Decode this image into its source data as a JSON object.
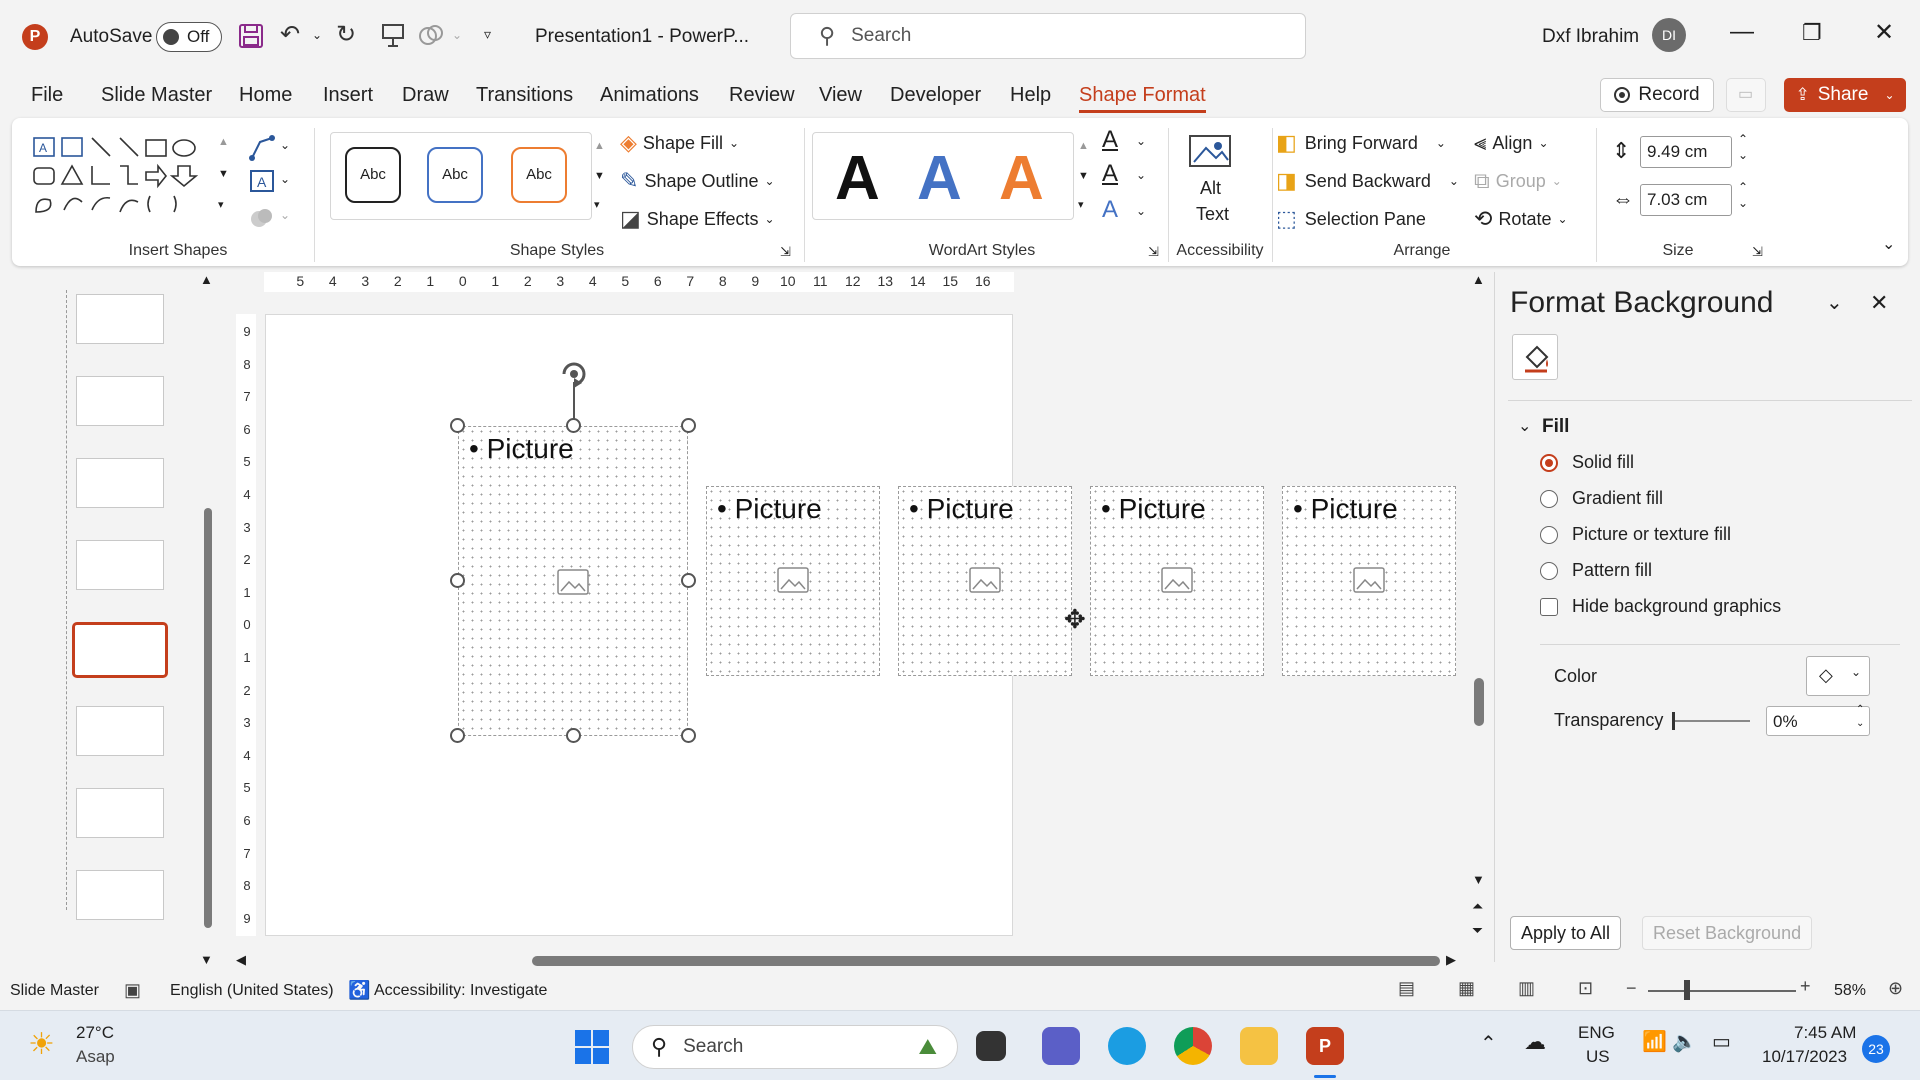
{
  "titlebar": {
    "app_icon": "P",
    "autosave_label": "AutoSave",
    "autosave_state": "Off",
    "doc_title": "Presentation1  -  PowerP...",
    "search_placeholder": "Search",
    "user_name": "Dxf Ibrahim",
    "user_initials": "DI"
  },
  "menu": {
    "items": [
      "File",
      "Slide Master",
      "Home",
      "Insert",
      "Draw",
      "Transitions",
      "Animations",
      "Review",
      "View",
      "Developer",
      "Help",
      "Shape Format"
    ],
    "active": "Shape Format",
    "record_label": "Record",
    "share_label": "Share"
  },
  "ribbon": {
    "insert_shapes_label": "Insert Shapes",
    "shape_styles": {
      "label": "Shape Styles",
      "preset": "Abc",
      "fill": "Shape Fill",
      "outline": "Shape Outline",
      "effects": "Shape Effects"
    },
    "wordart": {
      "label": "WordArt Styles",
      "letter": "A"
    },
    "accessibility": {
      "label": "Accessibility",
      "alt_text_1": "Alt",
      "alt_text_2": "Text"
    },
    "arrange": {
      "label": "Arrange",
      "bring_forward": "Bring Forward",
      "send_backward": "Send Backward",
      "selection_pane": "Selection Pane",
      "align": "Align",
      "group": "Group",
      "rotate": "Rotate"
    },
    "size": {
      "label": "Size",
      "height": "9.49 cm",
      "width": "7.03 cm"
    }
  },
  "ruler": {
    "h_ticks": [
      "5",
      "4",
      "3",
      "2",
      "1",
      "0",
      "1",
      "2",
      "3",
      "4",
      "5",
      "6",
      "7",
      "8",
      "9",
      "10",
      "11",
      "12",
      "13",
      "14",
      "15",
      "16"
    ],
    "v_ticks": [
      "9",
      "8",
      "7",
      "6",
      "5",
      "4",
      "3",
      "2",
      "1",
      "0",
      "1",
      "2",
      "3",
      "4",
      "5",
      "6",
      "7",
      "8",
      "9"
    ]
  },
  "slide": {
    "placeholders": [
      {
        "label": "Picture",
        "selected": true
      },
      {
        "label": "Picture",
        "selected": false
      },
      {
        "label": "Picture",
        "selected": false
      },
      {
        "label": "Picture",
        "selected": false
      },
      {
        "label": "Picture",
        "selected": false
      }
    ]
  },
  "format_pane": {
    "title": "Format Background",
    "section": "Fill",
    "options": [
      "Solid fill",
      "Gradient fill",
      "Picture or texture fill",
      "Pattern fill"
    ],
    "selected_option": "Solid fill",
    "hide_graphics": "Hide background graphics",
    "color_label": "Color",
    "transparency_label": "Transparency",
    "transparency_value": "0%",
    "apply_all": "Apply to All",
    "reset": "Reset Background"
  },
  "statusbar": {
    "view": "Slide Master",
    "language": "English (United States)",
    "accessibility": "Accessibility: Investigate",
    "zoom": "58%"
  },
  "taskbar": {
    "weather_temp": "27°C",
    "weather_desc": "Asap",
    "search_placeholder": "Search",
    "lang_1": "ENG",
    "lang_2": "US",
    "time": "7:45 AM",
    "date": "10/17/2023",
    "notification_count": "23"
  },
  "colors": {
    "accent": "#c43e1c",
    "wordart_blue": "#4472c4",
    "wordart_orange": "#ed7d31"
  }
}
